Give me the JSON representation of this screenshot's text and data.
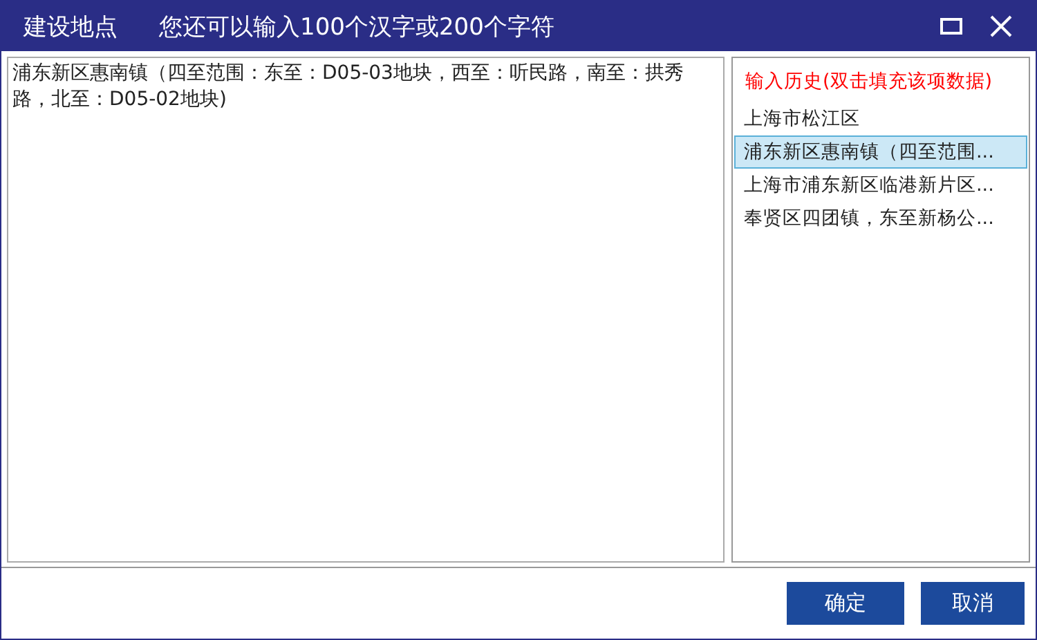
{
  "window": {
    "title": "建设地点",
    "hint": "您还可以输入100个汉字或200个字符"
  },
  "address_value": "浦东新区惠南镇（四至范围：东至：D05-03地块，西至：听民路，南至：拱秀路，北至：D05-02地块)",
  "history": {
    "title": "输入历史(双击填充该项数据)",
    "items": [
      {
        "label": "上海市松江区",
        "selected": false
      },
      {
        "label": "浦东新区惠南镇（四至范围...",
        "selected": true
      },
      {
        "label": "上海市浦东新区临港新片区...",
        "selected": false
      },
      {
        "label": "奉贤区四团镇，东至新杨公...",
        "selected": false
      }
    ]
  },
  "buttons": [
    "确定",
    "取消"
  ]
}
